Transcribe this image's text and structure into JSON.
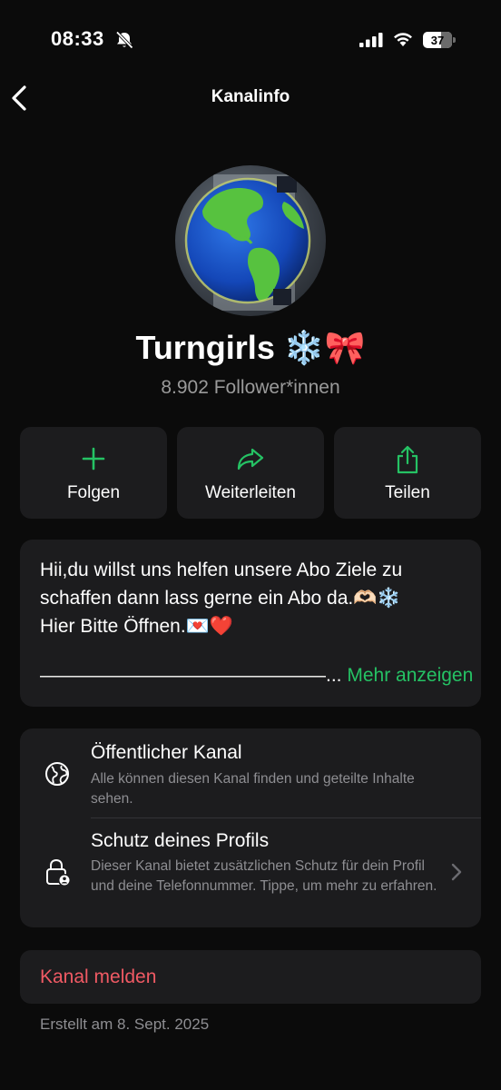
{
  "status_bar": {
    "time": "08:33",
    "battery_level": "37",
    "icons": [
      "bell-muted-icon",
      "cellular-signal-icon",
      "wifi-icon",
      "battery-icon"
    ]
  },
  "nav": {
    "title": "Kanalinfo",
    "back_icon": "chevron-left-icon"
  },
  "channel": {
    "name": "Turngirls ❄️🎀",
    "followers": "8.902 Follower*innen",
    "avatar": "globe-image"
  },
  "actions": [
    {
      "label": "Folgen",
      "icon": "plus-icon"
    },
    {
      "label": "Weiterleiten",
      "icon": "forward-arrow-icon"
    },
    {
      "label": "Teilen",
      "icon": "share-icon"
    }
  ],
  "description": {
    "line1": "Hii,du willst uns helfen unsere Abo Ziele zu",
    "line2": "schaffen dann lass gerne ein Abo da.🫶🏻❄️",
    "line3": "Hier Bitte Öffnen.💌❤️",
    "line_last": "———————————————...",
    "more_label": "Mehr anzeigen"
  },
  "info": {
    "public": {
      "title": "Öffentlicher Kanal",
      "subtitle": "Alle können diesen Kanal finden und geteilte Inhalte sehen.",
      "icon": "globe-icon"
    },
    "privacy": {
      "title": "Schutz deines Profils",
      "subtitle": "Dieser Kanal bietet zusätzlichen Schutz für dein Profil und deine Telefonnummer. Tippe, um mehr zu erfahren.",
      "icon": "lock-person-icon"
    }
  },
  "report": {
    "label": "Kanal melden"
  },
  "created": "Erstellt am 8. Sept. 2025",
  "colors": {
    "accent_green": "#25c264",
    "danger_red": "#f05a64",
    "card_bg": "#1c1c1e",
    "background": "#0b0b0b"
  }
}
